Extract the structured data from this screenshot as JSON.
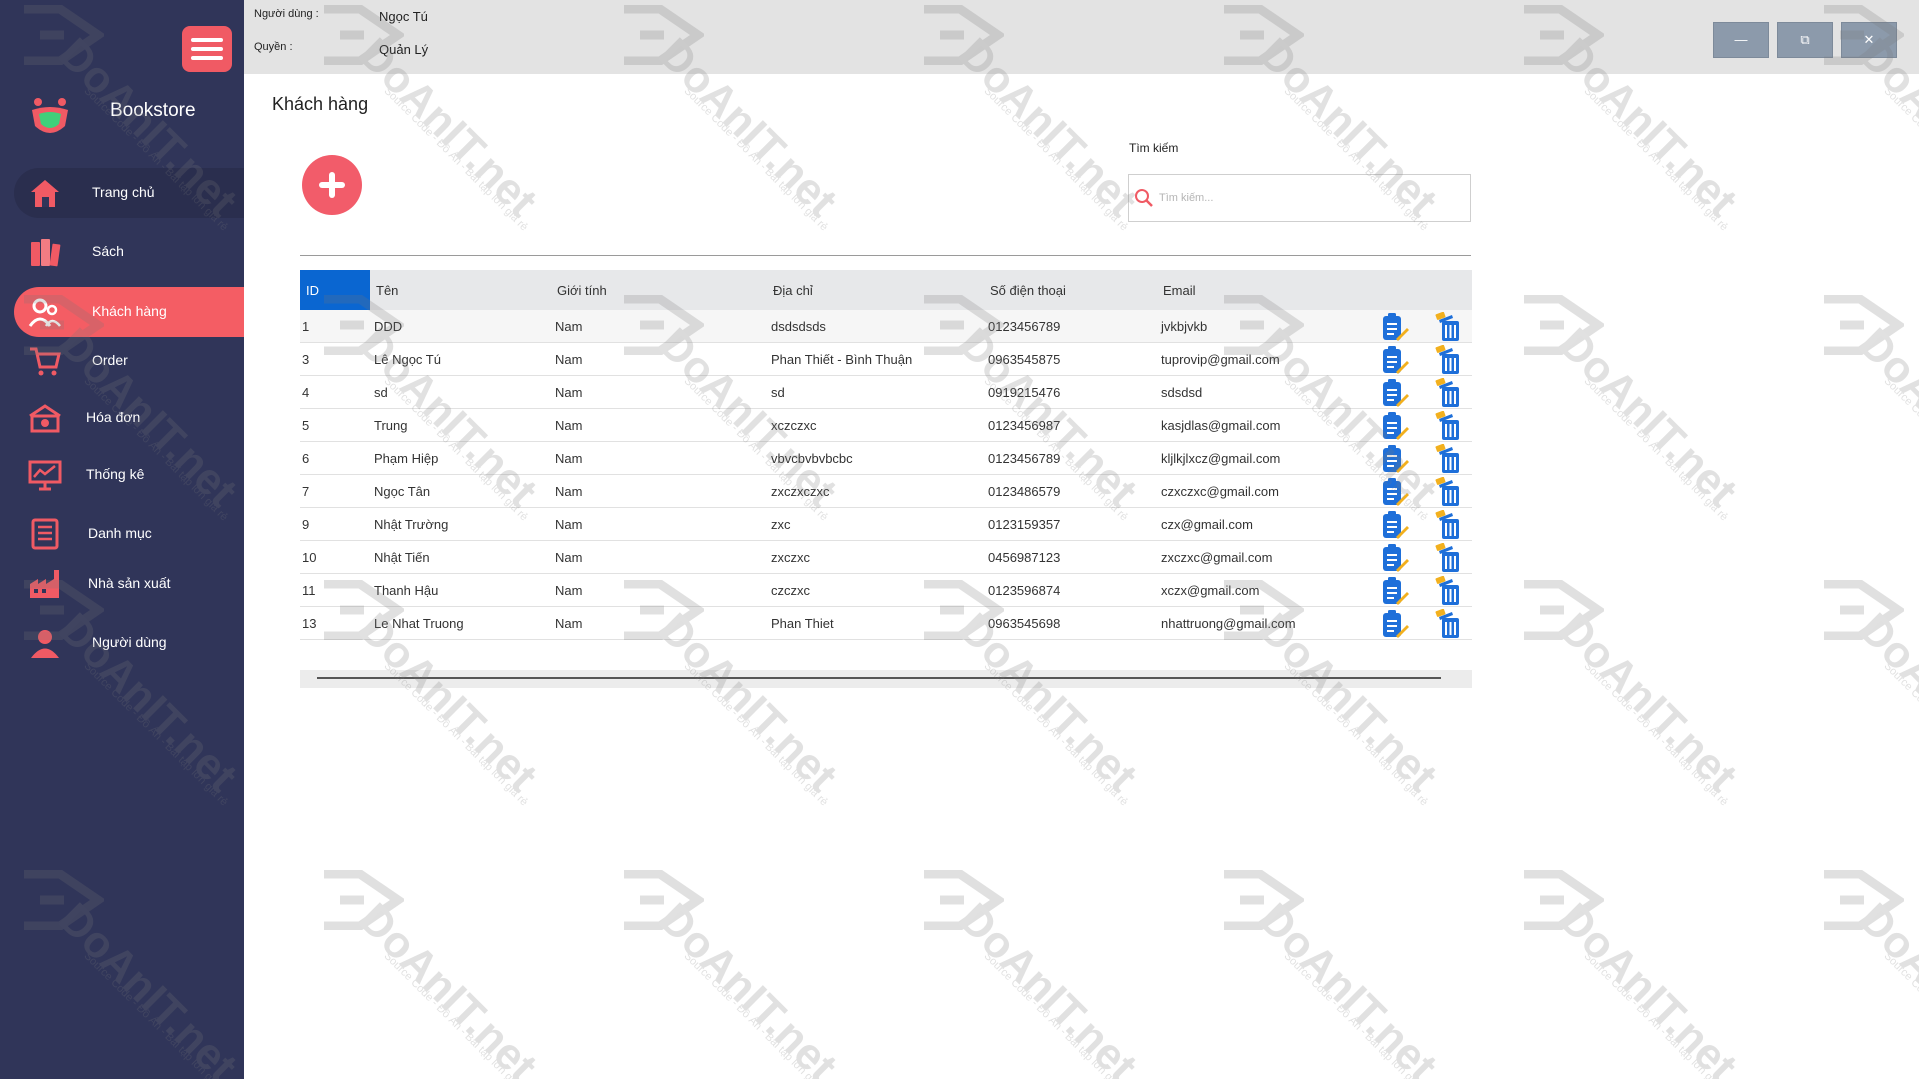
{
  "app": {
    "brand_name": "Bookstore"
  },
  "topbar": {
    "user_label": "Người dùng :",
    "user_value": "Ngọc Tú",
    "role_label": "Quyền :",
    "role_value": "Quản Lý",
    "minimize_symbol": "—",
    "restore_symbol": "⧉",
    "close_symbol": "✕"
  },
  "sidebar": {
    "items": [
      {
        "label": "Trang chủ",
        "icon": "home-icon"
      },
      {
        "label": "Sách",
        "icon": "books-icon"
      },
      {
        "label": "Khách hàng",
        "icon": "customers-icon",
        "active": true
      },
      {
        "label": "Order",
        "icon": "cart-icon"
      },
      {
        "label": "Hóa đơn",
        "icon": "invoice-icon"
      },
      {
        "label": "Thống kê",
        "icon": "chart-icon"
      },
      {
        "label": "Danh mục",
        "icon": "list-icon"
      },
      {
        "label": "Nhà sản xuất",
        "icon": "factory-icon"
      },
      {
        "label": "Người dùng",
        "icon": "user-icon"
      }
    ]
  },
  "main": {
    "title": "Khách hàng",
    "search_label": "Tìm kiếm",
    "search_placeholder": "Tìm kiếm..."
  },
  "table": {
    "columns": [
      "ID",
      "Tên",
      "Giới tính",
      "Địa chỉ",
      "Số điện thoại",
      "Email"
    ],
    "rows": [
      {
        "id": "1",
        "name": "DDD",
        "gender": "Nam",
        "address": "dsdsdsds",
        "phone": "0123456789",
        "email": "jvkbjvkb"
      },
      {
        "id": "3",
        "name": "Lê Ngọc Tú",
        "gender": "Nam",
        "address": "Phan Thiết - Bình Thuận",
        "phone": "0963545875",
        "email": "tuprovip@gmail.com"
      },
      {
        "id": "4",
        "name": "sd",
        "gender": "Nam",
        "address": "sd",
        "phone": "0919215476",
        "email": "sdsdsd"
      },
      {
        "id": "5",
        "name": "Trung",
        "gender": "Nam",
        "address": "xczczxc",
        "phone": "0123456987",
        "email": "kasjdlas@gmail.com"
      },
      {
        "id": "6",
        "name": "Phạm Hiệp",
        "gender": "Nam",
        "address": "vbvcbvbvbcbc",
        "phone": "0123456789",
        "email": "kljlkjlxcz@gmail.com"
      },
      {
        "id": "7",
        "name": "Ngọc Tân",
        "gender": "Nam",
        "address": "zxczxczxc",
        "phone": "0123486579",
        "email": "czxczxc@gmail.com"
      },
      {
        "id": "9",
        "name": "Nhật Trường",
        "gender": "Nam",
        "address": "zxc",
        "phone": "0123159357",
        "email": "czx@gmail.com"
      },
      {
        "id": "10",
        "name": "Nhật Tiến",
        "gender": "Nam",
        "address": "zxczxc",
        "phone": "0456987123",
        "email": "zxczxc@gmail.com"
      },
      {
        "id": "11",
        "name": "Thanh Hậu",
        "gender": "Nam",
        "address": "czczxc",
        "phone": "0123596874",
        "email": "xczx@gmail.com"
      },
      {
        "id": "13",
        "name": "Le Nhat Truong",
        "gender": "Nam",
        "address": "Phan Thiet",
        "phone": "0963545698",
        "email": "nhattruong@gmail.com"
      }
    ]
  },
  "watermark": {
    "text": "DoAnIT.net",
    "subtext": "Source Code - Đồ Án - Bài tập lớn giá rẻ"
  },
  "colors": {
    "sidebar_bg": "#303559",
    "accent": "#f45d64",
    "id_header": "#0a66d1",
    "window_button": "#8c9aab"
  }
}
